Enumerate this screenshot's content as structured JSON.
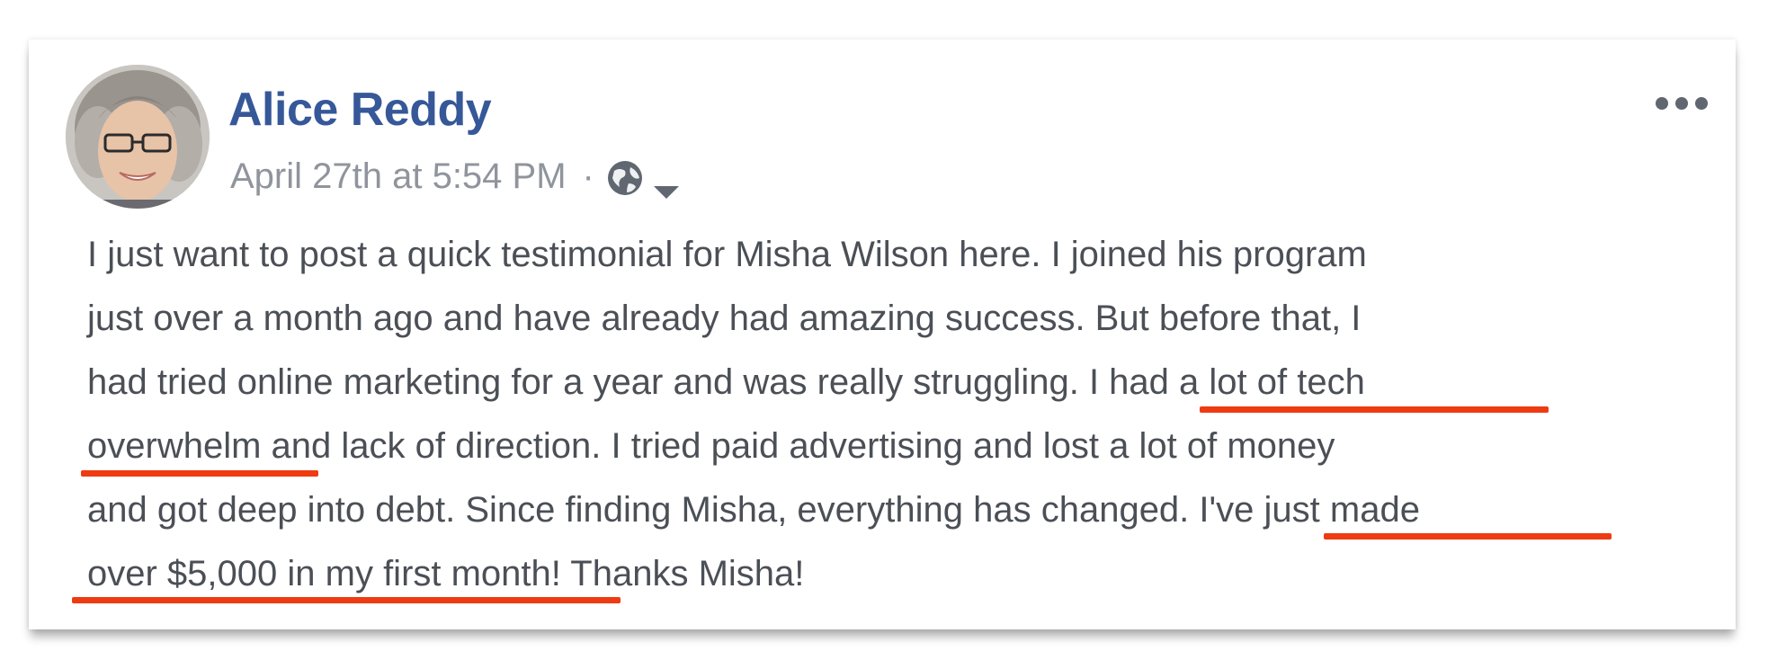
{
  "post": {
    "author": "Alice Reddy",
    "timestamp": "April 27th at 5:54 PM",
    "separator": "·",
    "audience_icon": "globe-icon",
    "audience_menu_icon": "caret-down-icon",
    "options_icon": "more-options-icon",
    "body_lines": [
      {
        "text": "I just want to post a quick testimonial for Misha Wilson here. I joined his program"
      },
      {
        "text": "just over a month ago and have already had amazing success. But before that, I"
      },
      {
        "pre": "had tried online marketing for a year and was really struggling. ",
        "highlight": "I had a lot of tech"
      },
      {
        "highlight": "overwhelm",
        "post": " and lack of direction. I tried paid advertising and lost a lot of money"
      },
      {
        "pre": "and got deep into debt. Since finding Misha, everything has changed. ",
        "highlight": "I've just made"
      },
      {
        "highlight": "over $5,000 in my first month",
        "post": "! Thanks Misha!"
      }
    ]
  },
  "colors": {
    "author": "#365899",
    "meta": "#90949c",
    "body_text": "#4b4f56",
    "highlight_underline": "#ee3b12"
  }
}
